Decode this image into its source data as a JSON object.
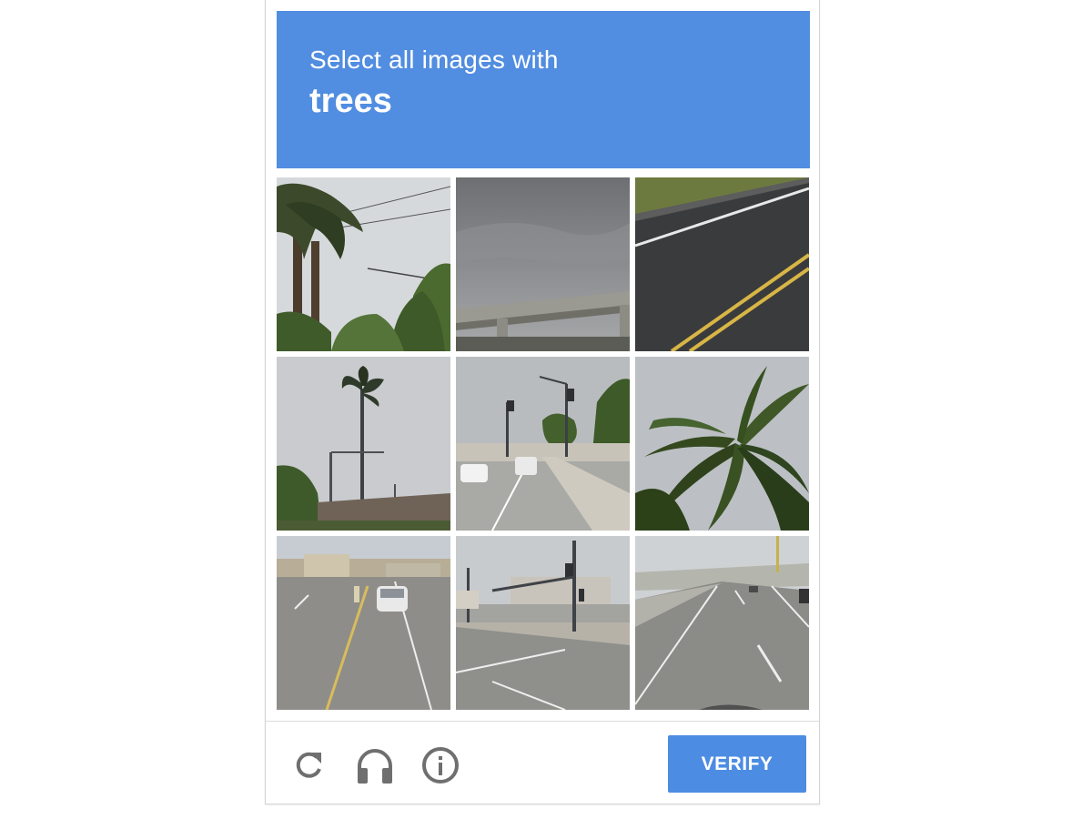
{
  "challenge": {
    "instruction": "Select all images with",
    "keyword": "trees"
  },
  "tiles": [
    {
      "name": "tile-1",
      "scene": "palm trees and power lines"
    },
    {
      "name": "tile-2",
      "scene": "cloudy sky over elevated highway"
    },
    {
      "name": "tile-3",
      "scene": "asphalt road with yellow lines"
    },
    {
      "name": "tile-4",
      "scene": "tall palm tree and streetlight"
    },
    {
      "name": "tile-5",
      "scene": "street with cars and traffic light"
    },
    {
      "name": "tile-6",
      "scene": "palm fronds close-up"
    },
    {
      "name": "tile-7",
      "scene": "road with white car"
    },
    {
      "name": "tile-8",
      "scene": "intersection with traffic signals"
    },
    {
      "name": "tile-9",
      "scene": "highway lanes"
    }
  ],
  "footer": {
    "reload_icon": "reload-icon",
    "audio_icon": "headphones-icon",
    "info_icon": "info-icon",
    "verify_label": "VERIFY"
  },
  "colors": {
    "header_bg": "#518de0",
    "button_bg": "#4c8ce3",
    "icon_gray": "#6f6f6f"
  }
}
